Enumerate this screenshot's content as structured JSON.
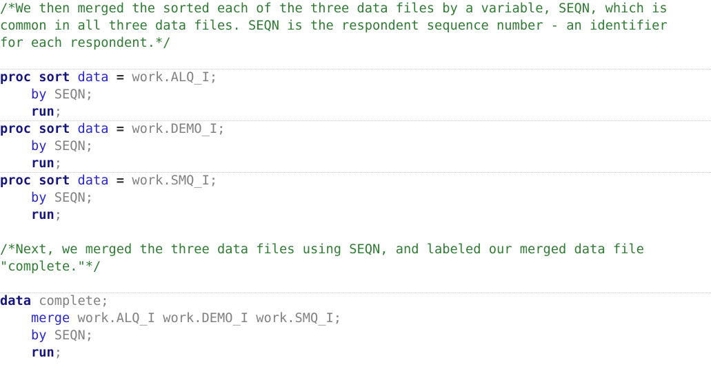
{
  "editor": {
    "name": "sas-code-editor",
    "language": "SAS",
    "background_color": "#ffffff",
    "separator_color": "#c8c8c8",
    "colors": {
      "comment": "#2e7d32",
      "keyword": "#15157f",
      "keyword_secondary": "#2626d6",
      "identifier": "#808080",
      "operator": "#2b2b2b"
    }
  },
  "lines": [
    {
      "index": 1,
      "separator": false,
      "tokens": [
        {
          "style": "comment",
          "text": "/*We then merged the sorted each of the three data files by a variable, SEQN, which is"
        }
      ]
    },
    {
      "index": 2,
      "separator": false,
      "tokens": [
        {
          "style": "comment",
          "text": "common in all three data files. SEQN is the respondent sequence number - an identifier"
        }
      ]
    },
    {
      "index": 3,
      "separator": false,
      "tokens": [
        {
          "style": "comment",
          "text": "for each respondent.*/"
        }
      ]
    },
    {
      "index": 4,
      "separator": false,
      "blank": true,
      "tokens": [
        {
          "style": "plain",
          "text": " "
        }
      ]
    },
    {
      "index": 5,
      "separator": true,
      "tokens": [
        {
          "style": "keyword",
          "text": "proc sort "
        },
        {
          "style": "kw2",
          "text": "data"
        },
        {
          "style": "plain",
          "text": " "
        },
        {
          "style": "op",
          "text": "="
        },
        {
          "style": "plain",
          "text": " work.ALQ_I;"
        }
      ]
    },
    {
      "index": 6,
      "separator": false,
      "tokens": [
        {
          "style": "plain",
          "text": "    "
        },
        {
          "style": "kw2",
          "text": "by"
        },
        {
          "style": "plain",
          "text": " SEQN;"
        }
      ]
    },
    {
      "index": 7,
      "separator": false,
      "tokens": [
        {
          "style": "plain",
          "text": "    "
        },
        {
          "style": "keyword",
          "text": "run"
        },
        {
          "style": "plain",
          "text": ";"
        }
      ]
    },
    {
      "index": 8,
      "separator": true,
      "tokens": [
        {
          "style": "keyword",
          "text": "proc sort "
        },
        {
          "style": "kw2",
          "text": "data"
        },
        {
          "style": "plain",
          "text": " "
        },
        {
          "style": "op",
          "text": "="
        },
        {
          "style": "plain",
          "text": " work.DEMO_I;"
        }
      ]
    },
    {
      "index": 9,
      "separator": false,
      "tokens": [
        {
          "style": "plain",
          "text": "    "
        },
        {
          "style": "kw2",
          "text": "by"
        },
        {
          "style": "plain",
          "text": " SEQN;"
        }
      ]
    },
    {
      "index": 10,
      "separator": false,
      "tokens": [
        {
          "style": "plain",
          "text": "    "
        },
        {
          "style": "keyword",
          "text": "run"
        },
        {
          "style": "plain",
          "text": ";"
        }
      ]
    },
    {
      "index": 11,
      "separator": true,
      "tokens": [
        {
          "style": "keyword",
          "text": "proc sort "
        },
        {
          "style": "kw2",
          "text": "data"
        },
        {
          "style": "plain",
          "text": " "
        },
        {
          "style": "op",
          "text": "="
        },
        {
          "style": "plain",
          "text": " work.SMQ_I;"
        }
      ]
    },
    {
      "index": 12,
      "separator": false,
      "tokens": [
        {
          "style": "plain",
          "text": "    "
        },
        {
          "style": "kw2",
          "text": "by"
        },
        {
          "style": "plain",
          "text": " SEQN;"
        }
      ]
    },
    {
      "index": 13,
      "separator": false,
      "tokens": [
        {
          "style": "plain",
          "text": "    "
        },
        {
          "style": "keyword",
          "text": "run"
        },
        {
          "style": "plain",
          "text": ";"
        }
      ]
    },
    {
      "index": 14,
      "separator": false,
      "blank": true,
      "tokens": [
        {
          "style": "plain",
          "text": " "
        }
      ]
    },
    {
      "index": 15,
      "separator": false,
      "tokens": [
        {
          "style": "comment",
          "text": "/*Next, we merged the three data files using SEQN, and labeled our merged data file"
        }
      ]
    },
    {
      "index": 16,
      "separator": false,
      "tokens": [
        {
          "style": "comment",
          "text": "\"complete.\"*/"
        }
      ]
    },
    {
      "index": 17,
      "separator": false,
      "blank": true,
      "tokens": [
        {
          "style": "plain",
          "text": " "
        }
      ]
    },
    {
      "index": 18,
      "separator": true,
      "tokens": [
        {
          "style": "keyword",
          "text": "data"
        },
        {
          "style": "plain",
          "text": " complete;"
        }
      ]
    },
    {
      "index": 19,
      "separator": false,
      "tokens": [
        {
          "style": "plain",
          "text": "    "
        },
        {
          "style": "kw2",
          "text": "merge"
        },
        {
          "style": "plain",
          "text": " work.ALQ_I work.DEMO_I work.SMQ_I;"
        }
      ]
    },
    {
      "index": 20,
      "separator": false,
      "tokens": [
        {
          "style": "plain",
          "text": "    "
        },
        {
          "style": "kw2",
          "text": "by"
        },
        {
          "style": "plain",
          "text": " SEQN;"
        }
      ]
    },
    {
      "index": 21,
      "separator": false,
      "tokens": [
        {
          "style": "plain",
          "text": "    "
        },
        {
          "style": "keyword",
          "text": "run"
        },
        {
          "style": "plain",
          "text": ";"
        }
      ]
    }
  ]
}
